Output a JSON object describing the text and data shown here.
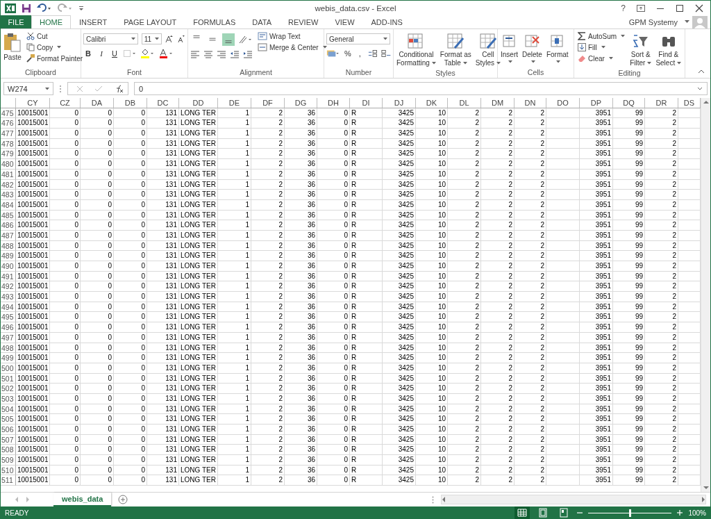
{
  "window": {
    "title": "webis_data.csv - Excel",
    "help": "?",
    "user": "GPM Systemy"
  },
  "ribbon_tabs": [
    {
      "label": "FILE",
      "kind": "file",
      "selected": false
    },
    {
      "label": "HOME",
      "kind": "tab",
      "selected": true
    },
    {
      "label": "INSERT",
      "kind": "tab",
      "selected": false
    },
    {
      "label": "PAGE LAYOUT",
      "kind": "tab",
      "selected": false
    },
    {
      "label": "FORMULAS",
      "kind": "tab",
      "selected": false
    },
    {
      "label": "DATA",
      "kind": "tab",
      "selected": false
    },
    {
      "label": "REVIEW",
      "kind": "tab",
      "selected": false
    },
    {
      "label": "VIEW",
      "kind": "tab",
      "selected": false
    },
    {
      "label": "ADD-INS",
      "kind": "tab",
      "selected": false
    }
  ],
  "ribbon": {
    "clipboard": {
      "title": "Clipboard",
      "paste": "Paste",
      "cut": "Cut",
      "copy": "Copy",
      "format_painter": "Format Painter"
    },
    "font": {
      "title": "Font",
      "family": "Calibri",
      "size": "11",
      "bold": "B",
      "italic": "I",
      "underline": "U"
    },
    "alignment": {
      "title": "Alignment",
      "vertical_align": [
        {
          "selected": false
        },
        {
          "selected": false
        },
        {
          "selected": true
        }
      ],
      "wrap_text": "Wrap Text",
      "merge_center": "Merge & Center"
    },
    "number": {
      "title": "Number",
      "format": "General",
      "percent": "%",
      "comma": ","
    },
    "styles": {
      "title": "Styles",
      "buttons": [
        {
          "lines": [
            "Conditional",
            "Formatting"
          ]
        },
        {
          "lines": [
            "Format as",
            "Table"
          ]
        },
        {
          "lines": [
            "Cell",
            "Styles"
          ]
        }
      ]
    },
    "cells": {
      "title": "Cells",
      "buttons": [
        {
          "label": "Insert"
        },
        {
          "label": "Delete"
        },
        {
          "label": "Format"
        }
      ]
    },
    "editing": {
      "title": "Editing",
      "autosum": "AutoSum",
      "fill": "Fill",
      "clear": "Clear",
      "buttons": [
        {
          "lines": [
            "Sort &",
            "Filter"
          ]
        },
        {
          "lines": [
            "Find &",
            "Select"
          ]
        }
      ]
    }
  },
  "formula_bar": {
    "name_box": "W274",
    "formula": "0"
  },
  "table": {
    "columns": [
      "CY",
      "CZ",
      "DA",
      "DB",
      "DC",
      "DD",
      "DE",
      "DF",
      "DG",
      "DH",
      "DI",
      "DJ",
      "DK",
      "DL",
      "DM",
      "DN",
      "DO",
      "DP",
      "DQ",
      "DR",
      "DS"
    ],
    "rows": [
      {
        "number": "475",
        "cells": [
          "10015001",
          "0",
          "0",
          "0",
          "131",
          "LONG TER",
          "1",
          "2",
          "36",
          "0",
          "R",
          "3425",
          "10",
          "2",
          "2",
          "2",
          null,
          "3951",
          "99",
          "2",
          null
        ]
      },
      {
        "number": "476",
        "cells": [
          "10015001",
          "0",
          "0",
          "0",
          "131",
          "LONG TER",
          "1",
          "2",
          "36",
          "0",
          "R",
          "3425",
          "10",
          "2",
          "2",
          "2",
          null,
          "3951",
          "99",
          "2",
          null
        ]
      },
      {
        "number": "477",
        "cells": [
          "10015001",
          "0",
          "0",
          "0",
          "131",
          "LONG TER",
          "1",
          "2",
          "36",
          "0",
          "R",
          "3425",
          "10",
          "2",
          "2",
          "2",
          null,
          "3951",
          "99",
          "2",
          null
        ]
      },
      {
        "number": "478",
        "cells": [
          "10015001",
          "0",
          "0",
          "0",
          "131",
          "LONG TER",
          "1",
          "2",
          "36",
          "0",
          "R",
          "3425",
          "10",
          "2",
          "2",
          "2",
          null,
          "3951",
          "99",
          "2",
          null
        ]
      },
      {
        "number": "479",
        "cells": [
          "10015001",
          "0",
          "0",
          "0",
          "131",
          "LONG TER",
          "1",
          "2",
          "36",
          "0",
          "R",
          "3425",
          "10",
          "2",
          "2",
          "2",
          null,
          "3951",
          "99",
          "2",
          null
        ]
      },
      {
        "number": "480",
        "cells": [
          "10015001",
          "0",
          "0",
          "0",
          "131",
          "LONG TER",
          "1",
          "2",
          "36",
          "0",
          "R",
          "3425",
          "10",
          "2",
          "2",
          "2",
          null,
          "3951",
          "99",
          "2",
          null
        ]
      },
      {
        "number": "481",
        "cells": [
          "10015001",
          "0",
          "0",
          "0",
          "131",
          "LONG TER",
          "1",
          "2",
          "36",
          "0",
          "R",
          "3425",
          "10",
          "2",
          "2",
          "2",
          null,
          "3951",
          "99",
          "2",
          null
        ]
      },
      {
        "number": "482",
        "cells": [
          "10015001",
          "0",
          "0",
          "0",
          "131",
          "LONG TER",
          "1",
          "2",
          "36",
          "0",
          "R",
          "3425",
          "10",
          "2",
          "2",
          "2",
          null,
          "3951",
          "99",
          "2",
          null
        ]
      },
      {
        "number": "483",
        "cells": [
          "10015001",
          "0",
          "0",
          "0",
          "131",
          "LONG TER",
          "1",
          "2",
          "36",
          "0",
          "R",
          "3425",
          "10",
          "2",
          "2",
          "2",
          null,
          "3951",
          "99",
          "2",
          null
        ]
      },
      {
        "number": "484",
        "cells": [
          "10015001",
          "0",
          "0",
          "0",
          "131",
          "LONG TER",
          "1",
          "2",
          "36",
          "0",
          "R",
          "3425",
          "10",
          "2",
          "2",
          "2",
          null,
          "3951",
          "99",
          "2",
          null
        ]
      },
      {
        "number": "485",
        "cells": [
          "10015001",
          "0",
          "0",
          "0",
          "131",
          "LONG TER",
          "1",
          "2",
          "36",
          "0",
          "R",
          "3425",
          "10",
          "2",
          "2",
          "2",
          null,
          "3951",
          "99",
          "2",
          null
        ]
      },
      {
        "number": "486",
        "cells": [
          "10015001",
          "0",
          "0",
          "0",
          "131",
          "LONG TER",
          "1",
          "2",
          "36",
          "0",
          "R",
          "3425",
          "10",
          "2",
          "2",
          "2",
          null,
          "3951",
          "99",
          "2",
          null
        ]
      },
      {
        "number": "487",
        "cells": [
          "10015001",
          "0",
          "0",
          "0",
          "131",
          "LONG TER",
          "1",
          "2",
          "36",
          "0",
          "R",
          "3425",
          "10",
          "2",
          "2",
          "2",
          null,
          "3951",
          "99",
          "2",
          null
        ]
      },
      {
        "number": "488",
        "cells": [
          "10015001",
          "0",
          "0",
          "0",
          "131",
          "LONG TER",
          "1",
          "2",
          "36",
          "0",
          "R",
          "3425",
          "10",
          "2",
          "2",
          "2",
          null,
          "3951",
          "99",
          "2",
          null
        ]
      },
      {
        "number": "489",
        "cells": [
          "10015001",
          "0",
          "0",
          "0",
          "131",
          "LONG TER",
          "1",
          "2",
          "36",
          "0",
          "R",
          "3425",
          "10",
          "2",
          "2",
          "2",
          null,
          "3951",
          "99",
          "2",
          null
        ]
      },
      {
        "number": "490",
        "cells": [
          "10015001",
          "0",
          "0",
          "0",
          "131",
          "LONG TER",
          "1",
          "2",
          "36",
          "0",
          "R",
          "3425",
          "10",
          "2",
          "2",
          "2",
          null,
          "3951",
          "99",
          "2",
          null
        ]
      },
      {
        "number": "491",
        "cells": [
          "10015001",
          "0",
          "0",
          "0",
          "131",
          "LONG TER",
          "1",
          "2",
          "36",
          "0",
          "R",
          "3425",
          "10",
          "2",
          "2",
          "2",
          null,
          "3951",
          "99",
          "2",
          null
        ]
      },
      {
        "number": "492",
        "cells": [
          "10015001",
          "0",
          "0",
          "0",
          "131",
          "LONG TER",
          "1",
          "2",
          "36",
          "0",
          "R",
          "3425",
          "10",
          "2",
          "2",
          "2",
          null,
          "3951",
          "99",
          "2",
          null
        ]
      },
      {
        "number": "493",
        "cells": [
          "10015001",
          "0",
          "0",
          "0",
          "131",
          "LONG TER",
          "1",
          "2",
          "36",
          "0",
          "R",
          "3425",
          "10",
          "2",
          "2",
          "2",
          null,
          "3951",
          "99",
          "2",
          null
        ]
      },
      {
        "number": "494",
        "cells": [
          "10015001",
          "0",
          "0",
          "0",
          "131",
          "LONG TER",
          "1",
          "2",
          "36",
          "0",
          "R",
          "3425",
          "10",
          "2",
          "2",
          "2",
          null,
          "3951",
          "99",
          "2",
          null
        ]
      },
      {
        "number": "495",
        "cells": [
          "10015001",
          "0",
          "0",
          "0",
          "131",
          "LONG TER",
          "1",
          "2",
          "36",
          "0",
          "R",
          "3425",
          "10",
          "2",
          "2",
          "2",
          null,
          "3951",
          "99",
          "2",
          null
        ]
      },
      {
        "number": "496",
        "cells": [
          "10015001",
          "0",
          "0",
          "0",
          "131",
          "LONG TER",
          "1",
          "2",
          "36",
          "0",
          "R",
          "3425",
          "10",
          "2",
          "2",
          "2",
          null,
          "3951",
          "99",
          "2",
          null
        ]
      },
      {
        "number": "497",
        "cells": [
          "10015001",
          "0",
          "0",
          "0",
          "131",
          "LONG TER",
          "1",
          "2",
          "36",
          "0",
          "R",
          "3425",
          "10",
          "2",
          "2",
          "2",
          null,
          "3951",
          "99",
          "2",
          null
        ]
      },
      {
        "number": "498",
        "cells": [
          "10015001",
          "0",
          "0",
          "0",
          "131",
          "LONG TER",
          "1",
          "2",
          "36",
          "0",
          "R",
          "3425",
          "10",
          "2",
          "2",
          "2",
          null,
          "3951",
          "99",
          "2",
          null
        ]
      },
      {
        "number": "499",
        "cells": [
          "10015001",
          "0",
          "0",
          "0",
          "131",
          "LONG TER",
          "1",
          "2",
          "36",
          "0",
          "R",
          "3425",
          "10",
          "2",
          "2",
          "2",
          null,
          "3951",
          "99",
          "2",
          null
        ]
      },
      {
        "number": "500",
        "cells": [
          "10015001",
          "0",
          "0",
          "0",
          "131",
          "LONG TER",
          "1",
          "2",
          "36",
          "0",
          "R",
          "3425",
          "10",
          "2",
          "2",
          "2",
          null,
          "3951",
          "99",
          "2",
          null
        ]
      },
      {
        "number": "501",
        "cells": [
          "10015001",
          "0",
          "0",
          "0",
          "131",
          "LONG TER",
          "1",
          "2",
          "36",
          "0",
          "R",
          "3425",
          "10",
          "2",
          "2",
          "2",
          null,
          "3951",
          "99",
          "2",
          null
        ]
      },
      {
        "number": "502",
        "cells": [
          "10015001",
          "0",
          "0",
          "0",
          "131",
          "LONG TER",
          "1",
          "2",
          "36",
          "0",
          "R",
          "3425",
          "10",
          "2",
          "2",
          "2",
          null,
          "3951",
          "99",
          "2",
          null
        ]
      },
      {
        "number": "503",
        "cells": [
          "10015001",
          "0",
          "0",
          "0",
          "131",
          "LONG TER",
          "1",
          "2",
          "36",
          "0",
          "R",
          "3425",
          "10",
          "2",
          "2",
          "2",
          null,
          "3951",
          "99",
          "2",
          null
        ]
      },
      {
        "number": "504",
        "cells": [
          "10015001",
          "0",
          "0",
          "0",
          "131",
          "LONG TER",
          "1",
          "2",
          "36",
          "0",
          "R",
          "3425",
          "10",
          "2",
          "2",
          "2",
          null,
          "3951",
          "99",
          "2",
          null
        ]
      },
      {
        "number": "505",
        "cells": [
          "10015001",
          "0",
          "0",
          "0",
          "131",
          "LONG TER",
          "1",
          "2",
          "36",
          "0",
          "R",
          "3425",
          "10",
          "2",
          "2",
          "2",
          null,
          "3951",
          "99",
          "2",
          null
        ]
      },
      {
        "number": "506",
        "cells": [
          "10015001",
          "0",
          "0",
          "0",
          "131",
          "LONG TER",
          "1",
          "2",
          "36",
          "0",
          "R",
          "3425",
          "10",
          "2",
          "2",
          "2",
          null,
          "3951",
          "99",
          "2",
          null
        ]
      },
      {
        "number": "507",
        "cells": [
          "10015001",
          "0",
          "0",
          "0",
          "131",
          "LONG TER",
          "1",
          "2",
          "36",
          "0",
          "R",
          "3425",
          "10",
          "2",
          "2",
          "2",
          null,
          "3951",
          "99",
          "2",
          null
        ]
      },
      {
        "number": "508",
        "cells": [
          "10015001",
          "0",
          "0",
          "0",
          "131",
          "LONG TER",
          "1",
          "2",
          "36",
          "0",
          "R",
          "3425",
          "10",
          "2",
          "2",
          "2",
          null,
          "3951",
          "99",
          "2",
          null
        ]
      },
      {
        "number": "509",
        "cells": [
          "10015001",
          "0",
          "0",
          "0",
          "131",
          "LONG TER",
          "1",
          "2",
          "36",
          "0",
          "R",
          "3425",
          "10",
          "2",
          "2",
          "2",
          null,
          "3951",
          "99",
          "2",
          null
        ]
      },
      {
        "number": "510",
        "cells": [
          "10015001",
          "0",
          "0",
          "0",
          "131",
          "LONG TER",
          "1",
          "2",
          "36",
          "0",
          "R",
          "3425",
          "10",
          "2",
          "2",
          "2",
          null,
          "3951",
          "99",
          "2",
          null
        ]
      },
      {
        "number": "511",
        "cells": [
          "10015001",
          "0",
          "0",
          "0",
          "131",
          "LONG TER",
          "1",
          "2",
          "36",
          "0",
          "R",
          "3425",
          "10",
          "2",
          "2",
          "2",
          null,
          "3951",
          "99",
          "2",
          null
        ]
      }
    ]
  },
  "sheet_tabs": [
    {
      "label": "webis_data",
      "selected": true
    }
  ],
  "status_bar": {
    "status": "READY",
    "views": [
      {
        "selected": true
      },
      {
        "selected": false
      },
      {
        "selected": false
      }
    ],
    "zoom": {
      "level": 0.5,
      "reading": "100%"
    }
  }
}
